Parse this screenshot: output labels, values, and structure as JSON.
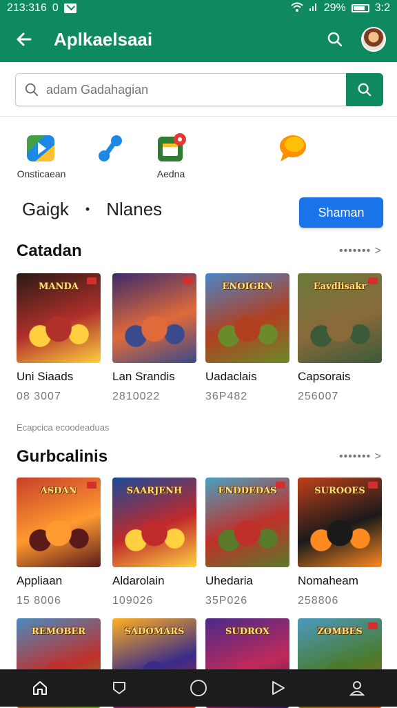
{
  "status_bar": {
    "time": "213:316",
    "o": "0",
    "battery": "29%",
    "clock": "3:2"
  },
  "app_bar": {
    "title": "Aplkaelsaai"
  },
  "search": {
    "placeholder": "adam Gadahagian"
  },
  "shortcuts": [
    {
      "label": "Onsticaean",
      "icon": "drive-icon"
    },
    {
      "label": "",
      "icon": "connect-icon"
    },
    {
      "label": "Aedna",
      "icon": "calendar-app-icon"
    },
    {
      "label": "",
      "icon": "chat-bubble-icon"
    }
  ],
  "filters": {
    "left": "Gaigk",
    "separator": "•",
    "right": "Nlanes",
    "button": "Shaman"
  },
  "sections": [
    {
      "title": "Catadan",
      "more": "••••••• >",
      "cards": [
        {
          "title": "Uni Siaads",
          "sub": "08 3007",
          "caption": "MANDA",
          "colors": [
            "#2a1a16",
            "#b0302a",
            "#ffcf40"
          ]
        },
        {
          "title": "Lan Srandis",
          "sub": "2810022",
          "caption": "",
          "colors": [
            "#3b2b6b",
            "#e06a3a",
            "#3a4a8a"
          ]
        },
        {
          "title": "Uadaclais",
          "sub": "36P482",
          "caption": "ENOIGRN",
          "colors": [
            "#4a86c7",
            "#b04020",
            "#6b8a2a"
          ]
        },
        {
          "title": "Capsorais",
          "sub": "256007",
          "caption": "Eavdlisakr",
          "colors": [
            "#6b7a3a",
            "#8a6a3a",
            "#3a5a3a"
          ]
        }
      ]
    },
    {
      "title": "Gurbcalinis",
      "more": "••••••• >",
      "caption_above": "Ecapcica ecoodeaduas",
      "cards": [
        {
          "title": "Appliaan",
          "sub": "15 8006",
          "caption": "ASDAN",
          "colors": [
            "#c7402a",
            "#ff9a30",
            "#5a1a1a"
          ]
        },
        {
          "title": "Aldarolain",
          "sub": "109026",
          "caption": "SAARJENH",
          "colors": [
            "#1a4a9a",
            "#c02a2a",
            "#ffd040"
          ]
        },
        {
          "title": "Uhedaria",
          "sub": "35P026",
          "caption": "ENDDEDAS",
          "colors": [
            "#4aa0c0",
            "#c0302a",
            "#5a7a2a"
          ]
        },
        {
          "title": "Nomaheam",
          "sub": "258806",
          "caption": "SUROOES",
          "colors": [
            "#c0401a",
            "#1a1a1a",
            "#ff8a20"
          ]
        }
      ]
    },
    {
      "title": "",
      "cards": [
        {
          "caption": "REMOBER",
          "colors": [
            "#4a8ac0",
            "#c0302a",
            "#6a9a2a"
          ]
        },
        {
          "caption": "SADOMARS",
          "colors": [
            "#ffb020",
            "#3a2a8a",
            "#c0302a"
          ]
        },
        {
          "caption": "SUDROX",
          "colors": [
            "#4a2a8a",
            "#c02a5a",
            "#2a1a4a"
          ]
        },
        {
          "caption": "ZOMBES",
          "colors": [
            "#4a9ac0",
            "#4a7a2a",
            "#c05a2a"
          ]
        }
      ]
    }
  ],
  "colors": {
    "brand": "#0f8a5f",
    "accent": "#1a73e8",
    "nav_bg": "#1c1c1c"
  }
}
